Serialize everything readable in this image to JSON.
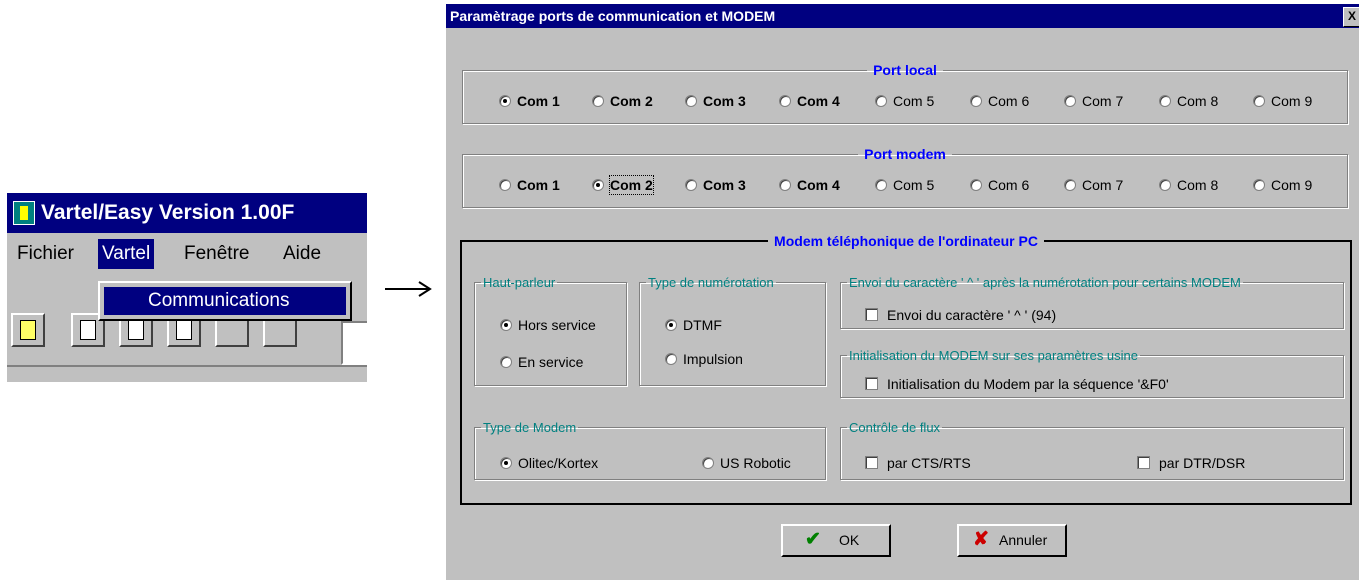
{
  "app": {
    "title": "Vartel/Easy Version 1.00F",
    "menus": [
      "Fichier",
      "Vartel",
      "Fenêtre",
      "Aide"
    ],
    "active_menu": "Vartel",
    "dropdown_item": "Communications"
  },
  "dialog": {
    "title": "Paramètrage ports de communication et MODEM",
    "close_label": "X",
    "port_local": {
      "legend": "Port local",
      "options": [
        "Com 1",
        "Com 2",
        "Com 3",
        "Com 4",
        "Com 5",
        "Com 6",
        "Com 7",
        "Com 8",
        "Com 9"
      ],
      "selected": "Com 1"
    },
    "port_modem": {
      "legend": "Port modem",
      "options": [
        "Com 1",
        "Com 2",
        "Com 3",
        "Com 4",
        "Com 5",
        "Com 6",
        "Com 7",
        "Com 8",
        "Com 9"
      ],
      "selected": "Com 2"
    },
    "modem_group": {
      "legend": "Modem téléphonique de l'ordinateur PC",
      "haut_parleur": {
        "legend": "Haut-parleur",
        "options": [
          "Hors service",
          "En service"
        ],
        "selected": "Hors service"
      },
      "type_numerotation": {
        "legend": "Type de numérotation",
        "options": [
          "DTMF",
          "Impulsion"
        ],
        "selected": "DTMF"
      },
      "envoi": {
        "legend": "Envoi du caractère ' ^ ' après la numérotation pour certains MODEM",
        "checkbox_label": "Envoi du caractère ' ^ ' (94)",
        "checked": false
      },
      "initialisation": {
        "legend": "Initialisation du MODEM sur ses paramètres usine",
        "checkbox_label": "Initialisation du Modem par la séquence '&F0'",
        "checked": false
      },
      "type_modem": {
        "legend": "Type de Modem",
        "options": [
          "Olitec/Kortex",
          "US Robotic"
        ],
        "selected": "Olitec/Kortex"
      },
      "controle_flux": {
        "legend": "Contrôle de flux",
        "options": [
          "par CTS/RTS",
          "par DTR/DSR"
        ],
        "checked": [
          false,
          false
        ]
      }
    },
    "ok_label": "OK",
    "cancel_label": "Annuler"
  },
  "colors": {
    "title_bar": "#000080",
    "face": "#c0c0c0",
    "legend_blue": "#0000ff",
    "legend_teal": "#008080",
    "ok_icon": "#008000",
    "cancel_icon": "#cc0000"
  },
  "icons": [
    "app-logo-icon",
    "new-document-icon",
    "open-document-icon",
    "save-icon",
    "print-icon",
    "arrow-right-icon",
    "checkmark-icon",
    "x-cross-icon"
  ]
}
